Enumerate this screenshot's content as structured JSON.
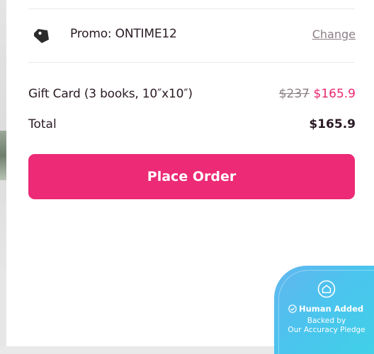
{
  "order_summary": {
    "promo": {
      "icon": "tag-icon",
      "label": "Promo: ONTIME12",
      "change_label": "Change"
    },
    "line_item": {
      "name": "Gift Card (3 books, 10″x10″)",
      "original_price": "$237",
      "price": "$165.9"
    },
    "total": {
      "label": "Total",
      "value": "$165.9"
    },
    "place_order_label": "Place Order"
  },
  "badge": {
    "icon": "house-icon",
    "check_icon": "check-circle-icon",
    "title": "Human Added",
    "line1": "Backed by",
    "line2": "Our Accuracy Pledge"
  },
  "colors": {
    "accent": "#ec2a75",
    "sale_price": "#e8286f",
    "badge_start": "#62b6ef",
    "badge_end": "#3fd2e6"
  }
}
